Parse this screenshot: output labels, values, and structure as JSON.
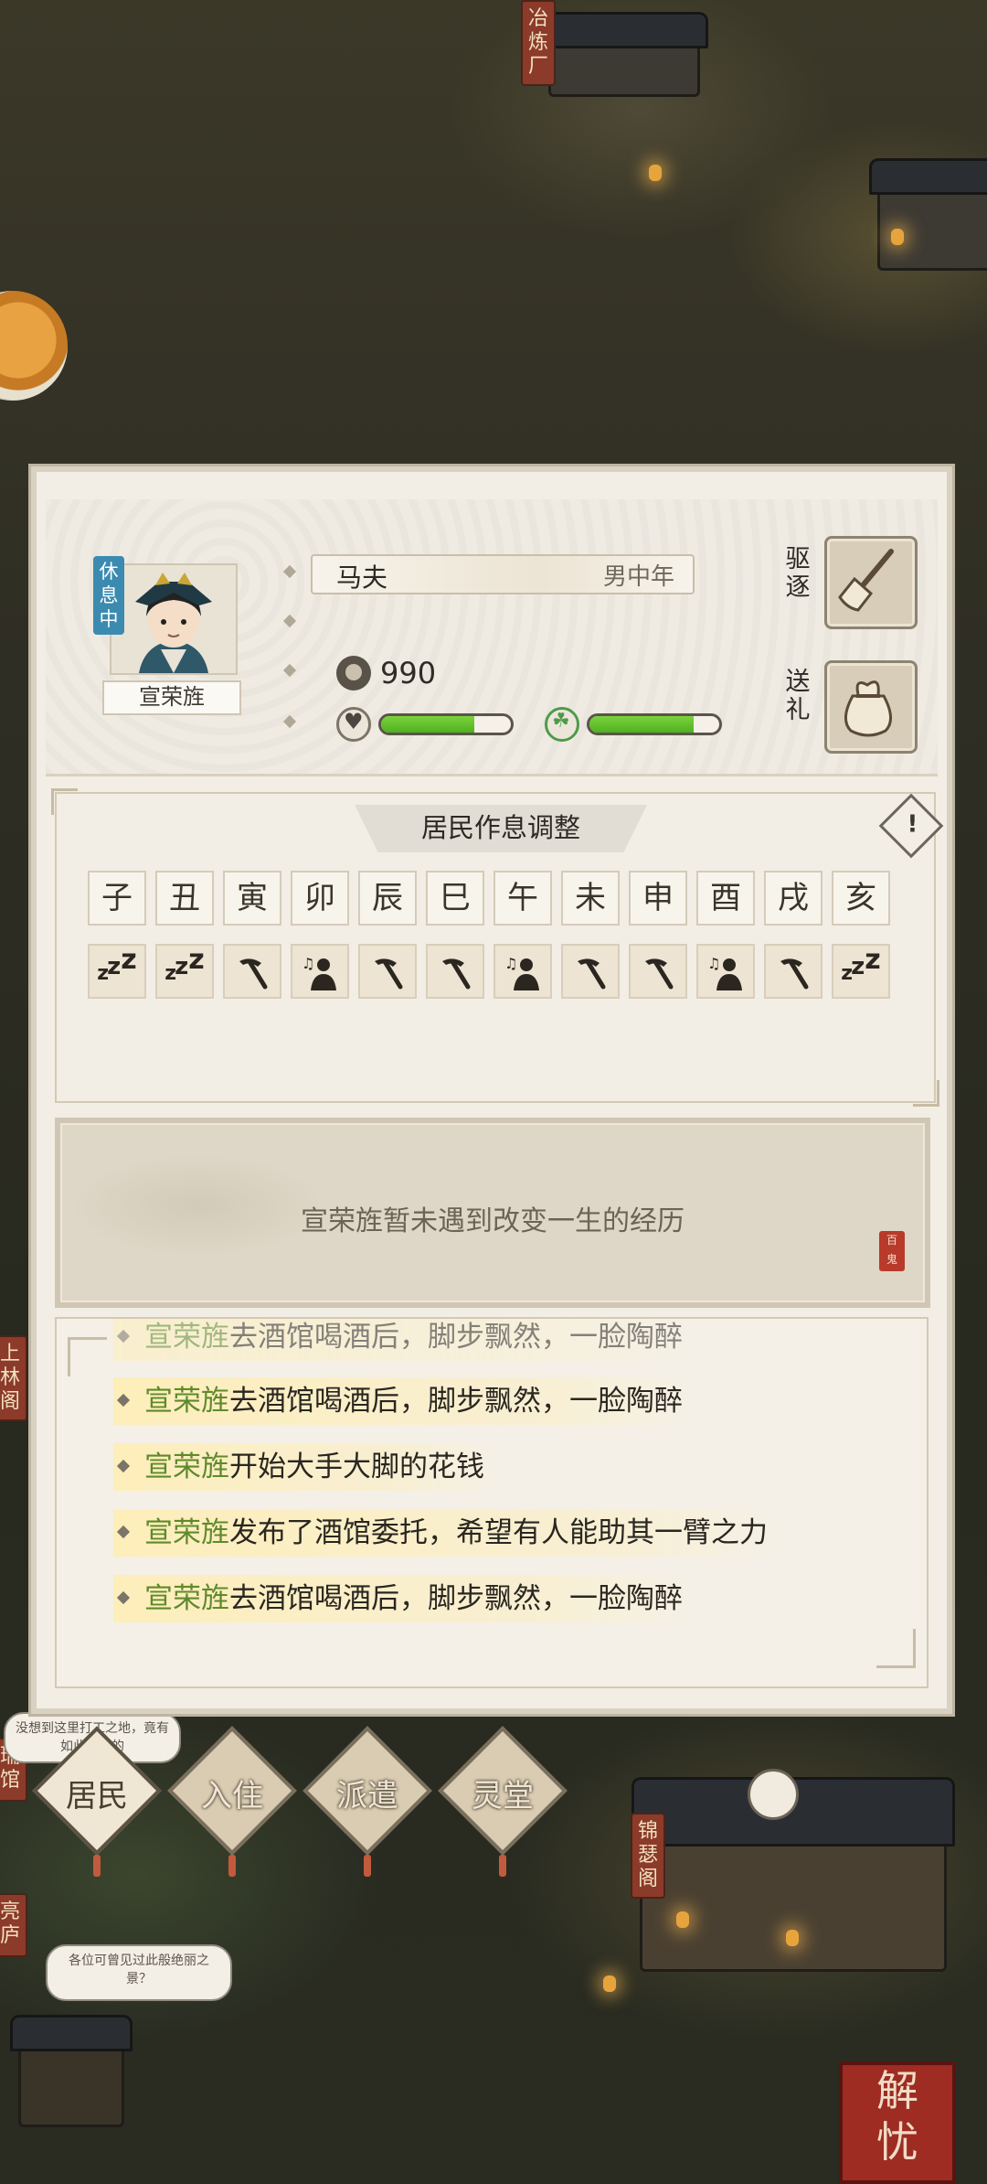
{
  "profile": {
    "status": "休息中",
    "name": "宣荣旌",
    "job": "马夫",
    "gender_age": "男中年",
    "gold": "990",
    "mood_fill": 0.72,
    "health_fill": 0.8,
    "expel_label": "驱逐",
    "gift_label": "送礼"
  },
  "schedule": {
    "title": "居民作息调整",
    "warn": "!",
    "hours": [
      "子",
      "丑",
      "寅",
      "卯",
      "辰",
      "巳",
      "午",
      "未",
      "申",
      "酉",
      "戌",
      "亥"
    ],
    "activities": [
      "sleep",
      "sleep",
      "work",
      "leisure",
      "work",
      "work",
      "leisure",
      "work",
      "work",
      "leisure",
      "work",
      "sleep"
    ],
    "activity_glyphs": {
      "sleep": "z",
      "work": "⛏",
      "leisure": "♫"
    }
  },
  "life_event": {
    "text": "宣荣旌暂未遇到改变一生的经历",
    "seal": "百鬼"
  },
  "log": {
    "entries": [
      {
        "name": "宣荣旌",
        "text": "去酒馆喝酒后，脚步飘然，一脸陶醉"
      },
      {
        "name": "宣荣旌",
        "text": "去酒馆喝酒后，脚步飘然，一脸陶醉"
      },
      {
        "name": "宣荣旌",
        "text": "开始大手大脚的花钱"
      },
      {
        "name": "宣荣旌",
        "text": "发布了酒馆委托，希望有人能助其一臂之力"
      },
      {
        "name": "宣荣旌",
        "text": "去酒馆喝酒后，脚步飘然，一脸陶醉"
      }
    ]
  },
  "tabs": [
    "居民",
    "入住",
    "派遣",
    "灵堂"
  ],
  "map": {
    "sign_top": "冶炼厂",
    "sign_left": "上林阁",
    "sign_right": "锦瑟阁",
    "sign_left2": "瑞馆",
    "sign_left3": "亮庐",
    "bubble1": "没想到这里打工之地，竟有如此美妙的",
    "bubble2": "各位可曾见过此般绝丽之景？",
    "seal_text": "解忧"
  },
  "colors": {
    "bar_green": "#5cbf2a",
    "name_highlight": "#5f8a2a",
    "status_tag": "#3b8bb0"
  }
}
